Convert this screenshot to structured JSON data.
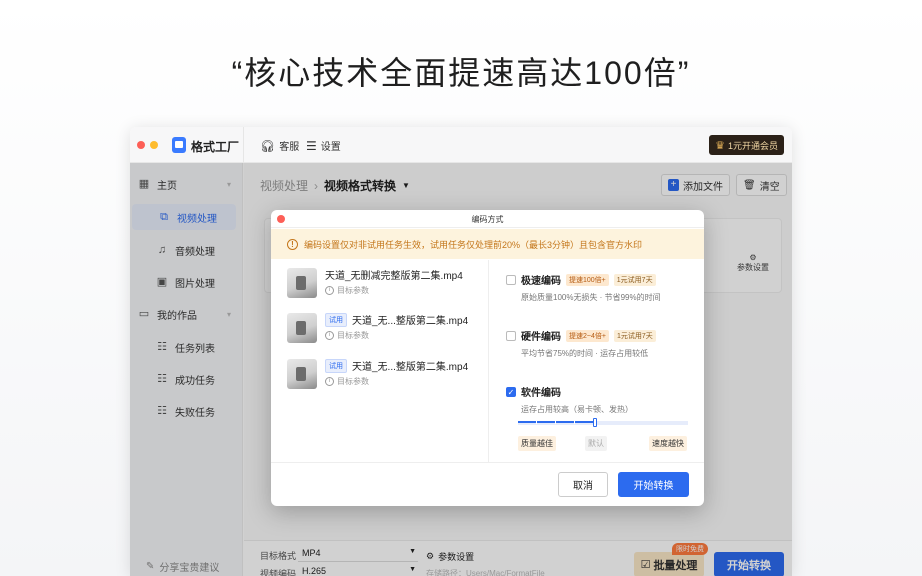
{
  "headline": "“核心技术全面提速高达100倍”",
  "app": {
    "title": "格式工厂",
    "toolbar": {
      "service": "客服",
      "settings": "设置"
    },
    "vip_label": "1元开通会员"
  },
  "sidebar": {
    "groups": [
      {
        "label": "主页",
        "icon": "grid-icon"
      },
      {
        "label": "我的作品",
        "icon": "folder-icon"
      }
    ],
    "home_items": [
      {
        "label": "视频处理",
        "icon": "video-icon",
        "active": true
      },
      {
        "label": "音频处理",
        "icon": "audio-icon"
      },
      {
        "label": "图片处理",
        "icon": "image-icon"
      }
    ],
    "work_items": [
      {
        "label": "任务列表",
        "icon": "list-icon"
      },
      {
        "label": "成功任务",
        "icon": "check-list-icon"
      },
      {
        "label": "失败任务",
        "icon": "fail-list-icon"
      }
    ],
    "feedback": "分享宝贵建议"
  },
  "main": {
    "breadcrumb": {
      "parent": "视频处理",
      "current": "视频格式转换"
    },
    "add_file": "添加文件",
    "clear": "清空",
    "param_settings": "参数设置",
    "bottom": {
      "target_format_label": "目标格式",
      "target_format": "MP4",
      "codec_label": "视频编码",
      "codec": "H.265",
      "param_settings": "参数设置",
      "output_path": "存储路径：Users/Mac/FormatFile",
      "batch": "批量处理",
      "batch_badge": "限时免费",
      "start": "开始转换"
    }
  },
  "dialog": {
    "title": "编码方式",
    "warning": "编码设置仅对非试用任务生效，试用任务仅处理前20%（最长3分钟）且包含官方水印",
    "files": [
      {
        "name": "天道_无删减完整版第二集.mp4",
        "trial": "",
        "param": "目标参数"
      },
      {
        "name": "天道_无...整版第二集.mp4",
        "trial": "试用",
        "param": "目标参数"
      },
      {
        "name": "天道_无...整版第二集.mp4",
        "trial": "试用",
        "param": "目标参数"
      }
    ],
    "encoders": [
      {
        "name": "极速编码",
        "tag1": "提速100倍+",
        "tag2": "1元试用7天",
        "desc": "原始质量100%无损失 · 节省99%的时间",
        "checked": false
      },
      {
        "name": "硬件编码",
        "tag1": "提速2~4倍+",
        "tag2": "1元试用7天",
        "desc": "平均节省75%的时间 · 运存占用较低",
        "checked": false
      },
      {
        "name": "软件编码",
        "tag1": "",
        "tag2": "",
        "desc": "运存占用较高（易卡顿、发热）",
        "checked": true
      }
    ],
    "slider": {
      "value": 0.45,
      "quality": "质量越佳",
      "default": "默认",
      "speed": "速度越快"
    },
    "cancel": "取消",
    "start": "开始转换"
  }
}
